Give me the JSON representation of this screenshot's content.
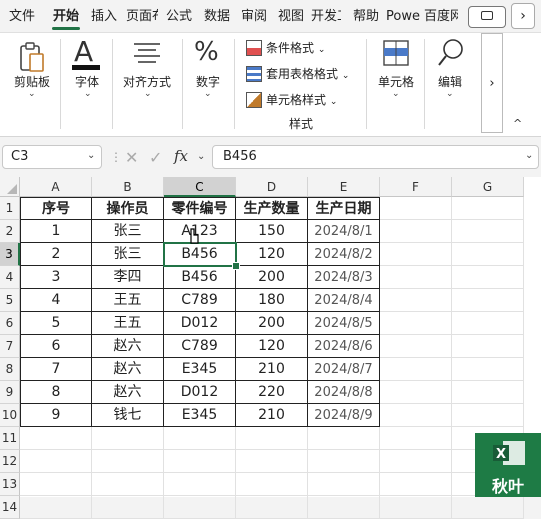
{
  "tabs": [
    {
      "label": "文件"
    },
    {
      "label": "开始"
    },
    {
      "label": "插入"
    },
    {
      "label": "页面布局"
    },
    {
      "label": "公式"
    },
    {
      "label": "数据"
    },
    {
      "label": "审阅"
    },
    {
      "label": "视图"
    },
    {
      "label": "开发工具"
    },
    {
      "label": "帮助"
    },
    {
      "label": "Power Pivot"
    },
    {
      "label": "百度网盘"
    }
  ],
  "active_tab": "开始",
  "ribbon": {
    "clipboard": "剪贴板",
    "font": "字体",
    "alignment": "对齐方式",
    "number": "数字",
    "styles": {
      "conditional": "条件格式",
      "table": "套用表格格式",
      "cell_styles": "单元格样式",
      "group": "样式"
    },
    "cells": "单元格",
    "editing": "编辑",
    "more": "›",
    "collapse": "^"
  },
  "formula_bar": {
    "name_box": "C3",
    "fx": "fx",
    "value": "B456"
  },
  "columns": [
    "A",
    "B",
    "C",
    "D",
    "E",
    "F",
    "G"
  ],
  "rows": [
    "1",
    "2",
    "3",
    "4",
    "5",
    "6",
    "7",
    "8",
    "9",
    "10",
    "11",
    "12",
    "13",
    "14"
  ],
  "selected_cell": "C3",
  "table": {
    "headers": [
      "序号",
      "操作员",
      "零件编号",
      "生产数量",
      "生产日期"
    ],
    "rows": [
      [
        "1",
        "张三",
        "A123",
        "150",
        "2024/8/1"
      ],
      [
        "2",
        "张三",
        "B456",
        "120",
        "2024/8/2"
      ],
      [
        "3",
        "李四",
        "B456",
        "200",
        "2024/8/3"
      ],
      [
        "4",
        "王五",
        "C789",
        "180",
        "2024/8/4"
      ],
      [
        "5",
        "王五",
        "D012",
        "200",
        "2024/8/5"
      ],
      [
        "6",
        "赵六",
        "C789",
        "120",
        "2024/8/6"
      ],
      [
        "7",
        "赵六",
        "E345",
        "210",
        "2024/8/7"
      ],
      [
        "8",
        "赵六",
        "D012",
        "220",
        "2024/8/8"
      ],
      [
        "9",
        "钱七",
        "E345",
        "210",
        "2024/8/9"
      ]
    ]
  },
  "watermark": {
    "text": "秋叶",
    "color": "#1e7b45"
  },
  "accent": "#217346"
}
